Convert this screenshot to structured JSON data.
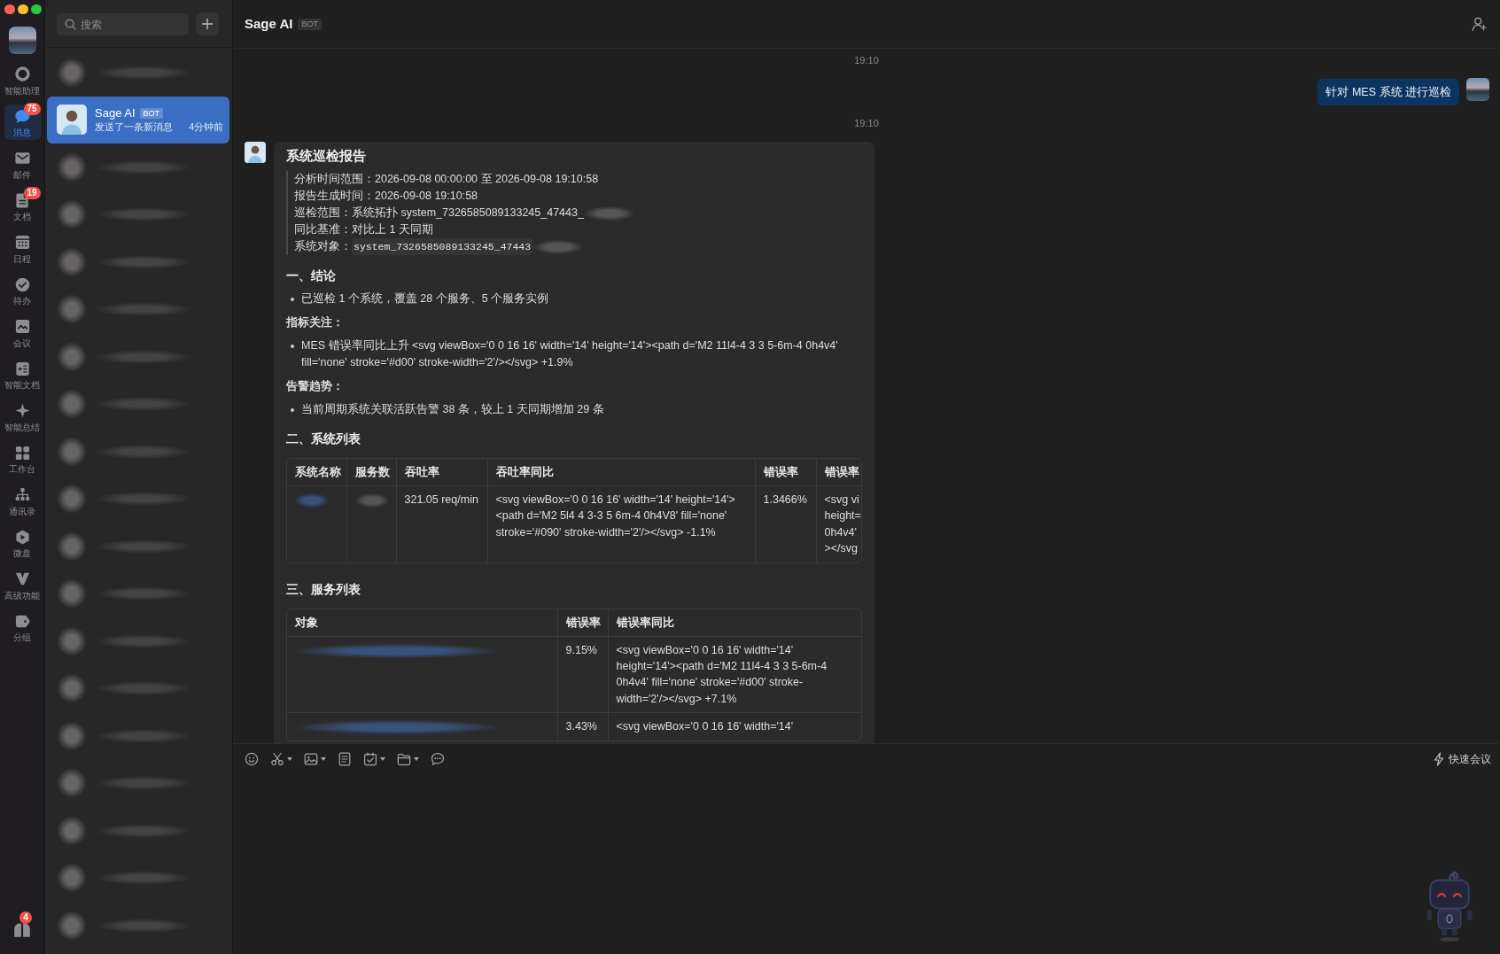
{
  "rail": {
    "items": [
      {
        "label": "智能助理",
        "selected": false
      },
      {
        "label": "消息",
        "selected": true,
        "badge": "75"
      },
      {
        "label": "邮件",
        "selected": false
      },
      {
        "label": "文档",
        "selected": false,
        "badge": "19"
      },
      {
        "label": "日程",
        "selected": false
      },
      {
        "label": "待办",
        "selected": false
      },
      {
        "label": "会议",
        "selected": false
      },
      {
        "label": "智能文档",
        "selected": false
      },
      {
        "label": "智能总结",
        "selected": false
      },
      {
        "label": "工作台",
        "selected": false
      },
      {
        "label": "通讯录",
        "selected": false
      },
      {
        "label": "微盘",
        "selected": false
      },
      {
        "label": "高级功能",
        "selected": false
      },
      {
        "label": "分组",
        "selected": false
      }
    ],
    "bottom": {
      "badge": "4"
    }
  },
  "chat_list": {
    "search": {
      "placeholder": "搜索"
    },
    "items": [
      {
        "kind": "redacted",
        "selected": false
      },
      {
        "kind": "contact",
        "name": "Sage AI",
        "tag": "BOT",
        "preview": "发送了一条新消息",
        "time": "4分钟前",
        "selected": true
      },
      {
        "kind": "redacted",
        "selected": false
      },
      {
        "kind": "redacted",
        "selected": false
      },
      {
        "kind": "redacted",
        "selected": false
      },
      {
        "kind": "redacted",
        "selected": false
      },
      {
        "kind": "redacted",
        "selected": false
      },
      {
        "kind": "redacted",
        "selected": false
      },
      {
        "kind": "redacted",
        "selected": false
      },
      {
        "kind": "redacted",
        "selected": false
      },
      {
        "kind": "redacted",
        "selected": false
      },
      {
        "kind": "redacted",
        "selected": false
      },
      {
        "kind": "redacted",
        "selected": false
      },
      {
        "kind": "redacted",
        "selected": false
      },
      {
        "kind": "redacted",
        "selected": false
      },
      {
        "kind": "redacted",
        "selected": false
      },
      {
        "kind": "redacted",
        "selected": false
      },
      {
        "kind": "redacted",
        "selected": false
      },
      {
        "kind": "redacted",
        "selected": false
      }
    ]
  },
  "chat": {
    "title": "Sage AI",
    "tag": "BOT",
    "messages": [
      {
        "kind": "time",
        "text": "19:10"
      },
      {
        "kind": "outgoing",
        "text": "针对 MES 系统 进行巡检"
      },
      {
        "kind": "time",
        "text": "19:10"
      },
      {
        "kind": "report",
        "title": "系统巡检报告",
        "info": [
          {
            "kind": "text",
            "text": "分析时间范围：2026-09-08 00:00:00 至 2026-09-08 19:10:58",
            "redacted": false
          },
          {
            "kind": "text",
            "text": "报告生成时间：2026-09-08 19:10:58",
            "redacted": false
          },
          {
            "kind": "text",
            "text": "巡检范围：系统拓扑 system_7326585089133245_47443_",
            "redacted": true
          },
          {
            "kind": "text",
            "text": "同比基准：对比上 1 天同期",
            "redacted": false
          },
          {
            "kind": "code",
            "label": "系统对象：",
            "code": "system_7326585089133245_47443",
            "redacted": true
          }
        ],
        "blocks": [
          {
            "kind": "heading",
            "text": "一、结论"
          },
          {
            "kind": "bullet",
            "text": "已巡检 1 个系统，覆盖 28 个服务、5 个服务实例"
          },
          {
            "kind": "label",
            "text": "指标关注："
          },
          {
            "kind": "bullet",
            "text": "MES 错误率同比上升 <svg viewBox='0 0 16 16' width='14' height='14'><path d='M2 11l4-4 3 3 5-6m-4 0h4v4' fill='none' stroke='#d00' stroke-width='2'/></svg> +1.9%"
          },
          {
            "kind": "label",
            "text": "告警趋势："
          },
          {
            "kind": "bullet",
            "text": "当前周期系统关联活跃告警 38 条，较上 1 天同期增加 29 条"
          },
          {
            "kind": "heading",
            "text": "二、系统列表"
          },
          {
            "kind": "table",
            "columns": [
              "系统名称",
              "服务数",
              "吞吐率",
              "吞吐率同比",
              "错误率",
              "错误率"
            ],
            "rows": [
              [
                {
                  "kind": "redacted_link"
                },
                {
                  "kind": "redacted"
                },
                {
                  "kind": "text",
                  "text": "321.05 req/min"
                },
                {
                  "kind": "text",
                  "text": "<svg viewBox='0 0 16 16' width='14' height='14'><path d='M2 5l4 4 3-3 5 6m-4 0h4V8' fill='none' stroke='#090' stroke-width='2'/></svg> -1.1%"
                },
                {
                  "kind": "text",
                  "text": "1.3466%"
                },
                {
                  "kind": "text",
                  "text": "<svg vi\nheight=\n0h4v4'\n></svg"
                }
              ]
            ]
          },
          {
            "kind": "heading",
            "text": "三、服务列表"
          },
          {
            "kind": "table",
            "columns": [
              "对象",
              "错误率",
              "错误率同比"
            ],
            "rows": [
              [
                {
                  "kind": "redacted_link"
                },
                {
                  "kind": "text",
                  "text": "9.15%"
                },
                {
                  "kind": "text",
                  "text": "<svg viewBox='0 0 16 16' width='14' height='14'><path d='M2 11l4-4 3 3 5-6m-4 0h4v4' fill='none' stroke='#d00' stroke-width='2'/></svg> +7.1%"
                }
              ],
              [
                {
                  "kind": "redacted_link"
                },
                {
                  "kind": "text",
                  "text": "3.43%"
                },
                {
                  "kind": "text",
                  "text": "<svg viewBox='0 0 16 16' width='14'"
                }
              ]
            ]
          }
        ]
      }
    ]
  },
  "composer": {
    "tools": [
      {
        "menu": false
      },
      {
        "menu": true
      },
      {
        "menu": true
      },
      {
        "menu": false
      },
      {
        "menu": true
      },
      {
        "menu": true
      },
      {
        "menu": false
      }
    ],
    "quick_meeting": "快速会议"
  }
}
